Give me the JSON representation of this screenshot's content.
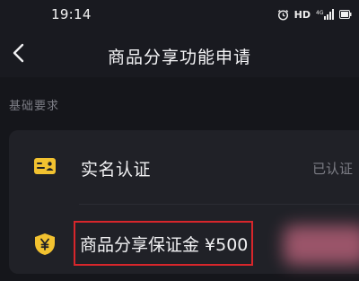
{
  "status_bar": {
    "time": "19:14",
    "hd_label": "HD",
    "network_label": "4G",
    "icons": [
      "alarm-icon",
      "signal-icon",
      "battery-icon"
    ]
  },
  "nav": {
    "back_icon": "chevron-left-icon",
    "title": "商品分享功能申请"
  },
  "section": {
    "label": "基础要求"
  },
  "requirements": [
    {
      "icon": "id-card-icon",
      "label": "实名认证",
      "status": "已认证"
    },
    {
      "icon": "shield-yen-icon",
      "label": "商品分享保证金 ¥500",
      "status": ""
    }
  ],
  "colors": {
    "background": "#15161b",
    "card": "#202127",
    "accent_yellow": "#f2c230",
    "highlight_red": "#d7262b"
  }
}
